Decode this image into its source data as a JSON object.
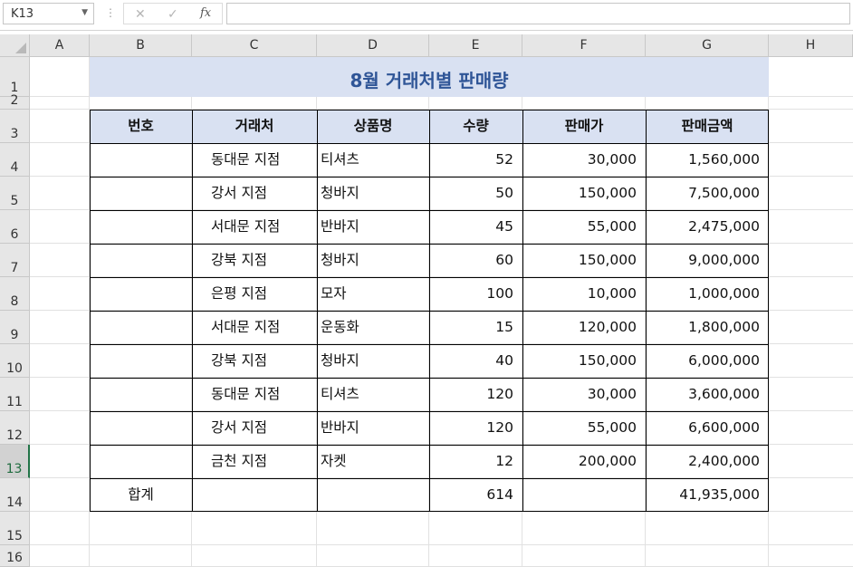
{
  "formula_bar": {
    "name_box": "K13",
    "cancel_icon": "✕",
    "enter_icon": "✓",
    "fx_label": "fx",
    "formula": ""
  },
  "columns": [
    "A",
    "B",
    "C",
    "D",
    "E",
    "F",
    "G",
    "H"
  ],
  "rows": [
    "1",
    "2",
    "3",
    "4",
    "5",
    "6",
    "7",
    "8",
    "9",
    "10",
    "11",
    "12",
    "13",
    "14",
    "15",
    "16"
  ],
  "active_row": "13",
  "sheet": {
    "title": "8월 거래처별 판매량",
    "headers": [
      "번호",
      "거래처",
      "상품명",
      "수량",
      "판매가",
      "판매금액"
    ],
    "data_rows": [
      {
        "no": "",
        "store": "동대문 지점",
        "product": "티셔츠",
        "qty": "52",
        "price": "30,000",
        "amount": "1,560,000"
      },
      {
        "no": "",
        "store": "강서 지점",
        "product": "청바지",
        "qty": "50",
        "price": "150,000",
        "amount": "7,500,000"
      },
      {
        "no": "",
        "store": "서대문 지점",
        "product": "반바지",
        "qty": "45",
        "price": "55,000",
        "amount": "2,475,000"
      },
      {
        "no": "",
        "store": "강북 지점",
        "product": "청바지",
        "qty": "60",
        "price": "150,000",
        "amount": "9,000,000"
      },
      {
        "no": "",
        "store": "은평 지점",
        "product": "모자",
        "qty": "100",
        "price": "10,000",
        "amount": "1,000,000"
      },
      {
        "no": "",
        "store": "서대문 지점",
        "product": "운동화",
        "qty": "15",
        "price": "120,000",
        "amount": "1,800,000"
      },
      {
        "no": "",
        "store": "강북 지점",
        "product": "청바지",
        "qty": "40",
        "price": "150,000",
        "amount": "6,000,000"
      },
      {
        "no": "",
        "store": "동대문 지점",
        "product": "티셔츠",
        "qty": "120",
        "price": "30,000",
        "amount": "3,600,000"
      },
      {
        "no": "",
        "store": "강서 지점",
        "product": "반바지",
        "qty": "120",
        "price": "55,000",
        "amount": "6,600,000"
      },
      {
        "no": "",
        "store": "금천 지점",
        "product": "자켓",
        "qty": "12",
        "price": "200,000",
        "amount": "2,400,000"
      }
    ],
    "total": {
      "label": "합계",
      "qty": "614",
      "amount": "41,935,000"
    }
  },
  "colors": {
    "header_fill": "#d9e1f2",
    "title_color": "#2f5597",
    "active_row": "#217346"
  }
}
